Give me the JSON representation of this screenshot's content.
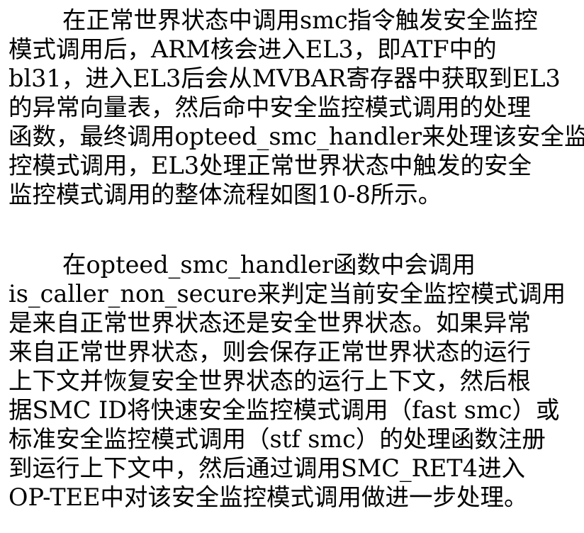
{
  "paragraphs": [
    {
      "lines": [
        "在正常世界状态中调用smc指令触发安全监控",
        "模式调用后，ARM核会进入EL3，即ATF中的",
        "bl31，进入EL3后会从MVBAR寄存器中获取到EL3",
        "的异常向量表，然后命中安全监控模式调用的处理",
        "函数，最终调用opteed_smc_handler来处理该安全监",
        "控模式调用，EL3处理正常世界状态中触发的安全",
        "监控模式调用的整体流程如图10-8所示。"
      ]
    },
    {
      "lines": [
        "在opteed_smc_handler函数中会调用",
        "is_caller_non_secure来判定当前安全监控模式调用",
        "是来自正常世界状态还是安全世界状态。如果异常",
        "来自正常世界状态，则会保存正常世界状态的运行",
        "上下文并恢复安全世界状态的运行上下文，然后根",
        "据SMC ID将快速安全监控模式调用（fast smc）或",
        "标准安全监控模式调用（stf smc）的处理函数注册",
        "到运行上下文中，然后通过调用SMC_RET4进入",
        "OP-TEE中对该安全监控模式调用做进一步处理。"
      ]
    }
  ]
}
